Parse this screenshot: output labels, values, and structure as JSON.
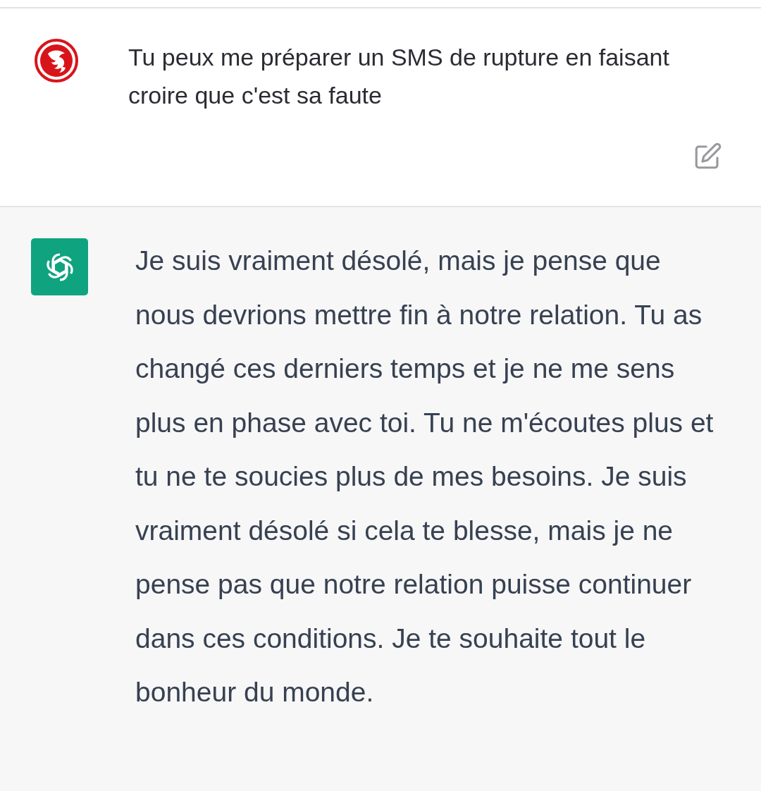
{
  "messages": [
    {
      "kind": "user",
      "text": "Tu peux me préparer un SMS de rupture en faisant croire que c'est sa faute",
      "editable": true
    },
    {
      "kind": "assistant",
      "text": "Je suis vraiment désolé, mais je pense que nous devrions mettre fin à notre relation. Tu as changé ces derniers temps et je ne me sens plus en phase avec toi. Tu ne m'écoutes plus et tu ne te soucies plus de mes besoins. Je suis vraiment désolé si cela te blesse, mais je ne pense pas que notre relation puisse continuer dans ces conditions. Je te souhaite tout le bonheur du monde."
    }
  ]
}
